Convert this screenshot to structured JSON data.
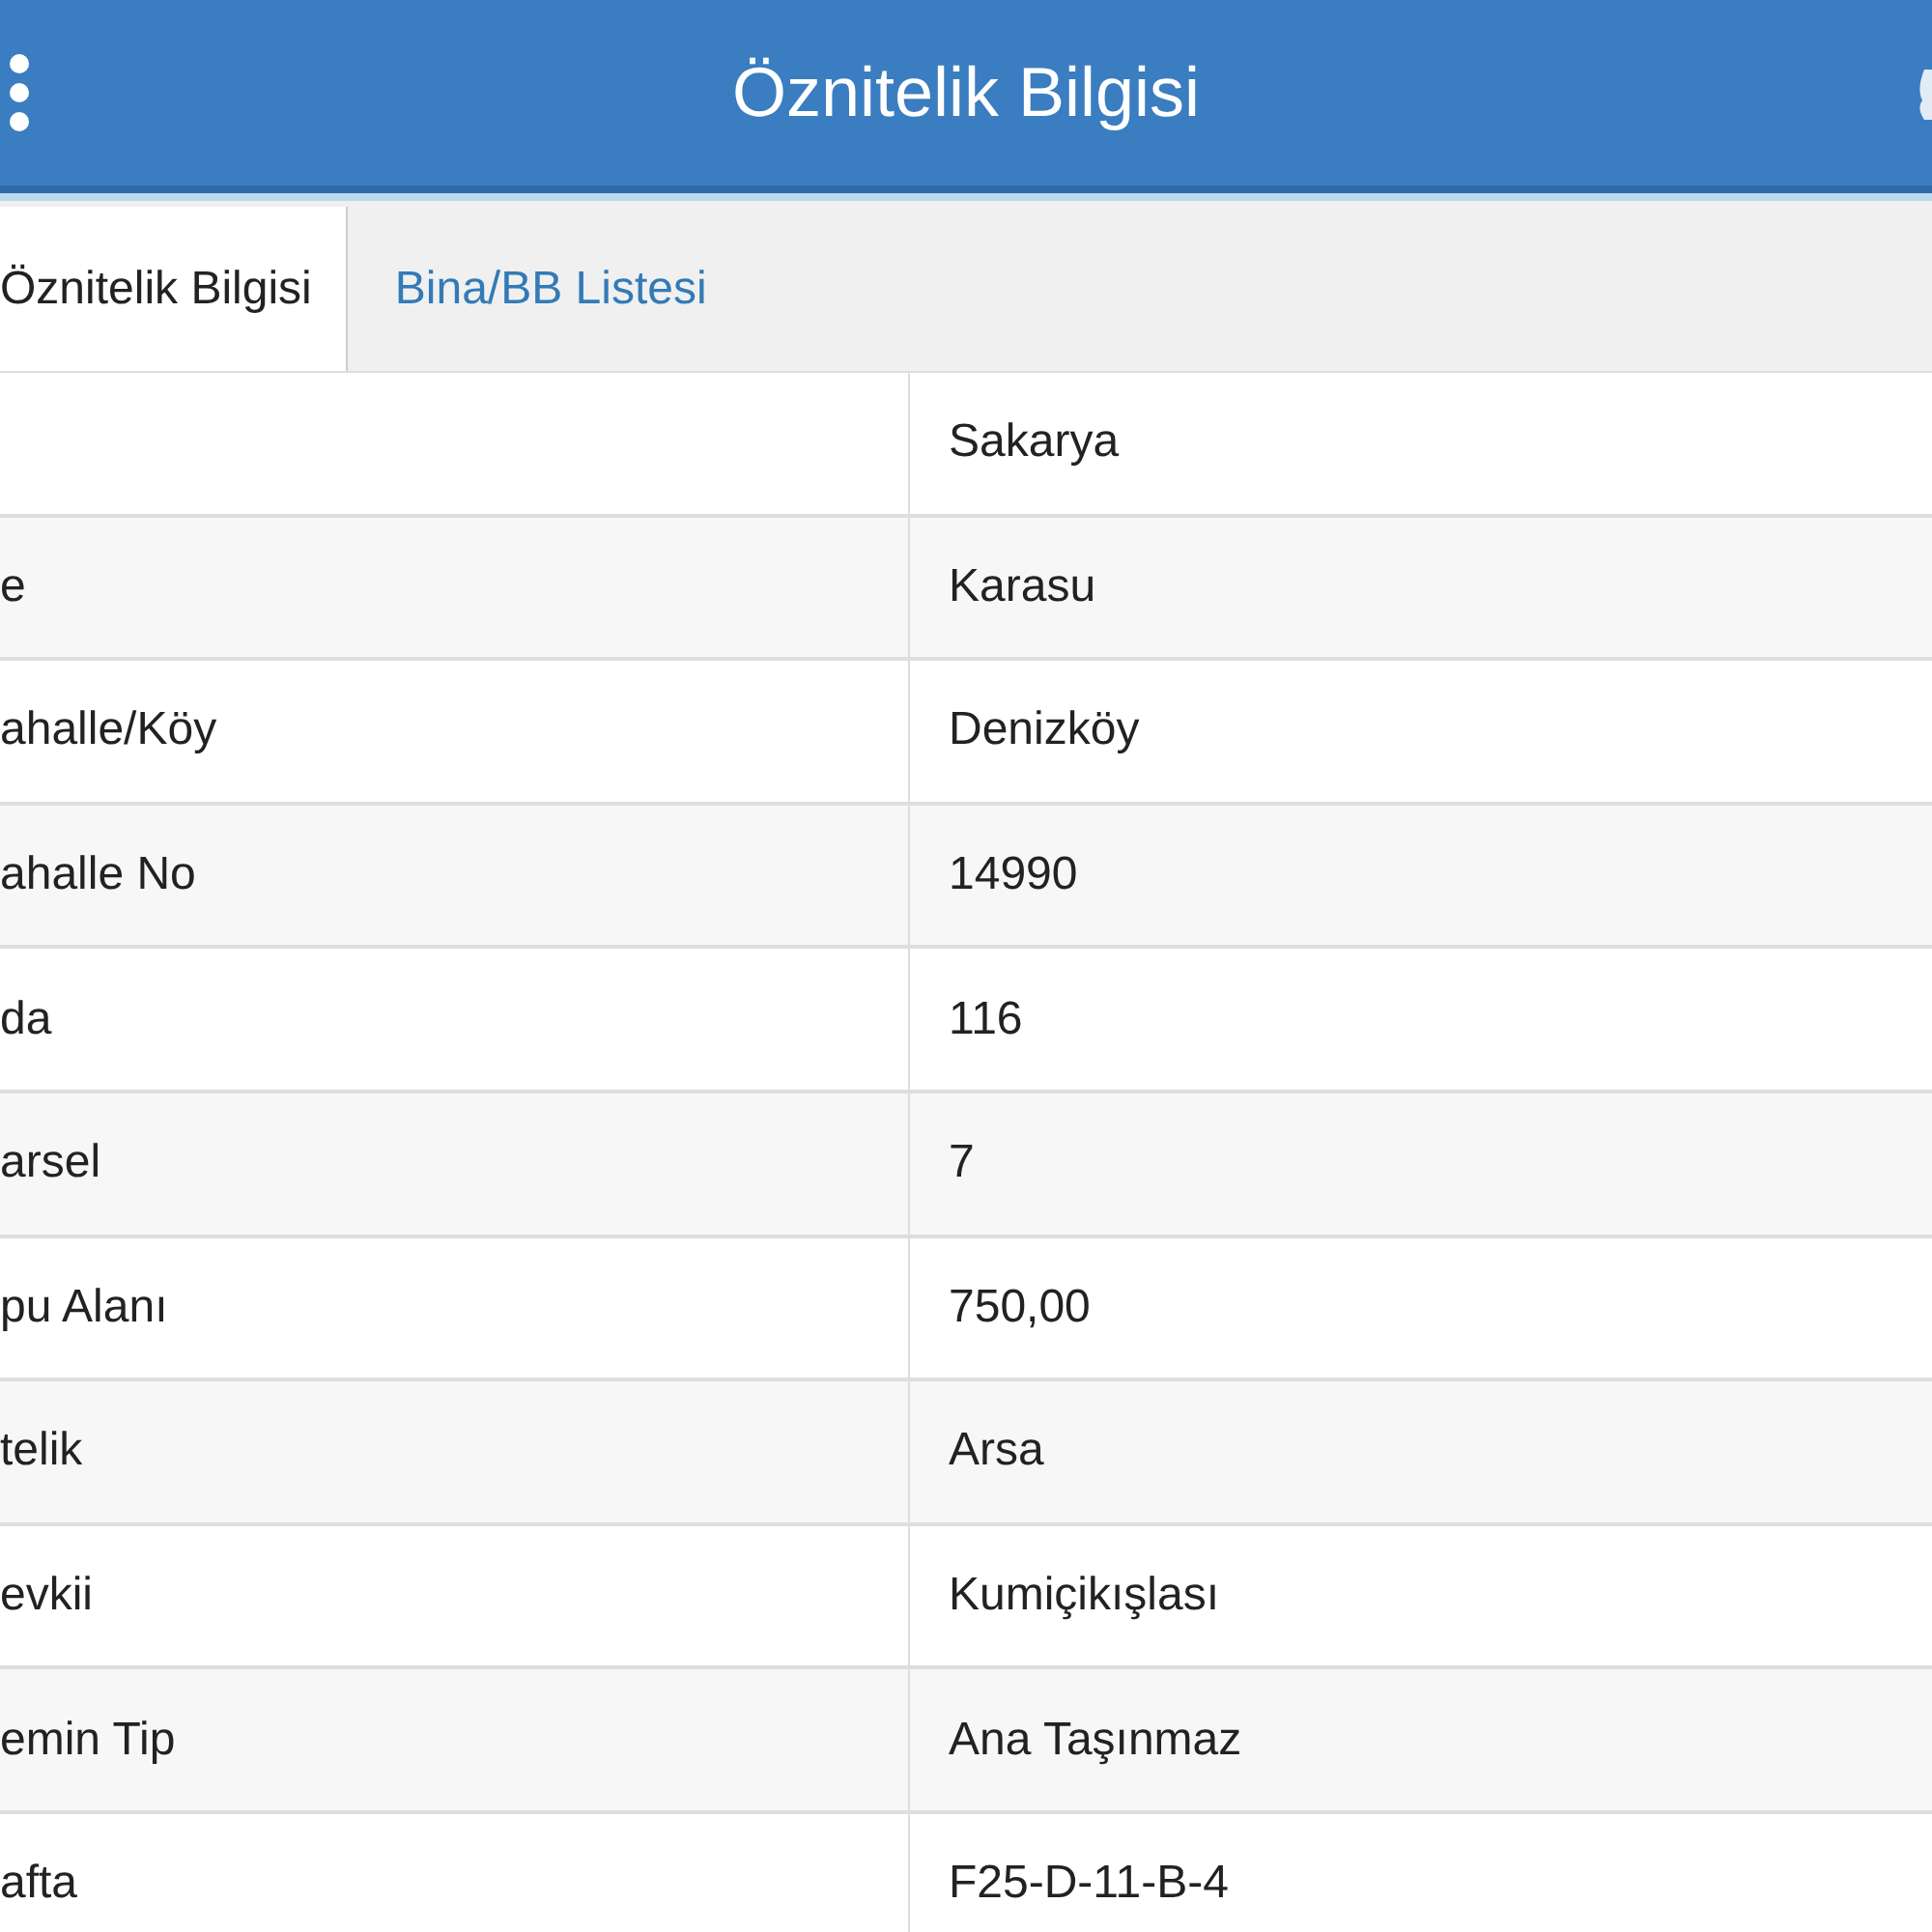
{
  "header": {
    "title": "Öznitelik Bilgisi"
  },
  "tabs": [
    {
      "label": "Öznitelik Bilgisi",
      "selected": true
    },
    {
      "label": "Bina/BB Listesi",
      "selected": false
    }
  ],
  "table": {
    "rows": [
      {
        "value": "Sakarya"
      },
      {
        "label": "e",
        "value": "Karasu"
      },
      {
        "label": "ahalle/Köy",
        "value": "Denizköy"
      },
      {
        "label": "ahalle No",
        "value": "14990"
      },
      {
        "label": "da",
        "value": "116"
      },
      {
        "label": "arsel",
        "value": "7"
      },
      {
        "label": "pu Alanı",
        "value": "750,00"
      },
      {
        "label": "telik",
        "value": "Arsa"
      },
      {
        "label": "evkii",
        "value": "Kumiçikışlası"
      },
      {
        "label": "emin Tip",
        "value": "Ana Taşınmaz"
      },
      {
        "label": "afta",
        "value": "F25-D-11-B-4"
      }
    ]
  }
}
